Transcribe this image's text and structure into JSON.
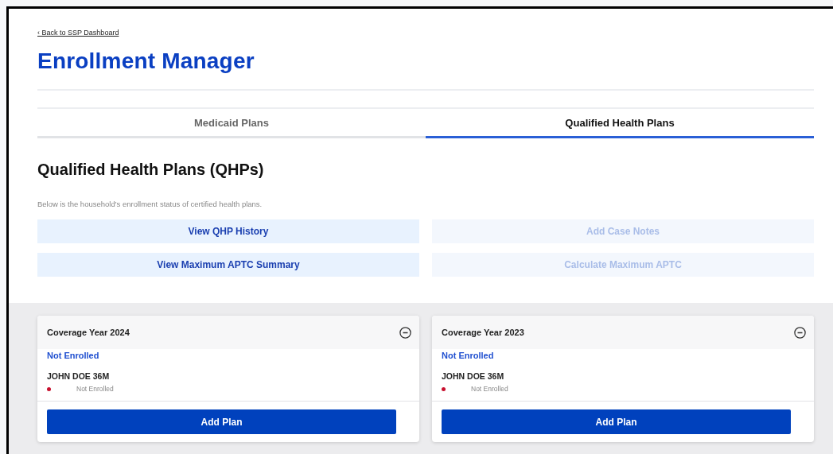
{
  "back_link": "‹ Back to SSP Dashboard",
  "title": "Enrollment Manager",
  "tabs": [
    {
      "label": "Medicaid Plans",
      "selected": false
    },
    {
      "label": "Qualified Health Plans",
      "selected": true
    }
  ],
  "section": {
    "heading": "Qualified Health Plans (QHPs)",
    "description": "Below is the household's enrollment status of certified health plans."
  },
  "actions": [
    {
      "label": "View QHP History",
      "disabled": false
    },
    {
      "label": "Add Case Notes",
      "disabled": true
    },
    {
      "label": "View Maximum APTC Summary",
      "disabled": false
    },
    {
      "label": "Calculate Maximum APTC",
      "disabled": true
    }
  ],
  "cards": [
    {
      "title": "Coverage Year 2024",
      "expanded": true,
      "status": "Not Enrolled",
      "members": [
        {
          "name": "JOHN DOE 36M",
          "color": "#c8102e",
          "status": "Not Enrolled"
        }
      ],
      "button": "Add Plan"
    },
    {
      "title": "Coverage Year 2023",
      "expanded": true,
      "status": "Not Enrolled",
      "members": [
        {
          "name": "JOHN DOE 36M",
          "color": "#c8102e",
          "status": "Not Enrolled"
        }
      ],
      "button": "Add Plan"
    }
  ]
}
